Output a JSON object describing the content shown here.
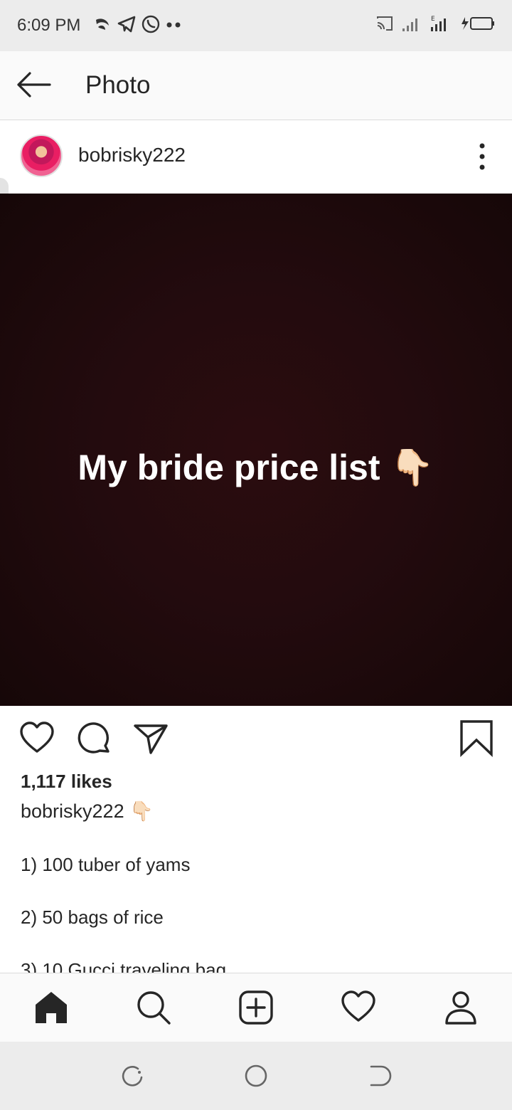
{
  "status_bar": {
    "time": "6:09 PM",
    "app_icons": [
      "signal-app-icon",
      "telegram-icon",
      "whatsapp-icon"
    ],
    "right_icons": [
      "cast-icon",
      "signal-bars-icon",
      "signal-bars-e-icon",
      "battery-charging-icon"
    ]
  },
  "header": {
    "title": "Photo",
    "back_icon": "arrow-left-icon"
  },
  "post": {
    "username": "bobrisky222",
    "photo_text": "My bride price list 👇🏻",
    "likes": "1,117 likes",
    "caption_user": "bobrisky222 👇🏻",
    "caption_lines": [
      "1) 100 tuber of yams",
      "2) 50 bags of rice",
      "3) 10 Gucci traveling bag"
    ]
  },
  "actions": [
    "heart-icon",
    "comment-icon",
    "share-icon",
    "bookmark-icon"
  ],
  "bottom_nav": [
    "home-icon",
    "search-icon",
    "add-post-icon",
    "activity-heart-icon",
    "profile-icon"
  ],
  "colors": {
    "text": "#262626",
    "photo_bg": "#230b0e",
    "bar_bg": "#fafafa"
  }
}
